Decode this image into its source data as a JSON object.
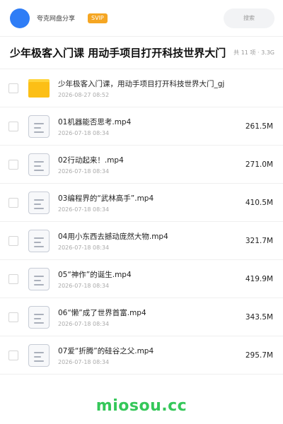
{
  "header": {
    "app_name": "夸克网盘分享",
    "badge": "SVIP",
    "search_placeholder": "搜索"
  },
  "share": {
    "title": "少年极客入门课 用动手项目打开科技世界大门",
    "meta": "共 11 项 · 3.3G"
  },
  "files": [
    {
      "name": "少年极客入门课，用动手项目打开科技世界大门_gj",
      "date": "2026-08-27 08:52",
      "size": "",
      "type": "folder-icon"
    },
    {
      "name": "01机器能否思考.mp4",
      "date": "2026-07-18 08:34",
      "size": "261.5M",
      "type": "file-icon"
    },
    {
      "name": "02行动起来！.mp4",
      "date": "2026-07-18 08:34",
      "size": "271.0M",
      "type": "file-icon"
    },
    {
      "name": "03编程界的“武林高手”.mp4",
      "date": "2026-07-18 08:34",
      "size": "410.5M",
      "type": "file-icon"
    },
    {
      "name": "04用小东西去撼动庞然大物.mp4",
      "date": "2026-07-18 08:34",
      "size": "321.7M",
      "type": "file-icon"
    },
    {
      "name": "05“神作”的诞生.mp4",
      "date": "2026-07-18 08:34",
      "size": "419.9M",
      "type": "file-icon"
    },
    {
      "name": "06“懒”成了世界首富.mp4",
      "date": "2026-07-18 08:34",
      "size": "343.5M",
      "type": "file-icon"
    },
    {
      "name": "07爱“折腾”的硅谷之父.mp4",
      "date": "2026-07-18 08:34",
      "size": "295.7M",
      "type": "file-icon"
    }
  ],
  "footer": {
    "brand": "miosou.cc"
  },
  "colors": {
    "accent": "#2f7df6",
    "badge": "#f5a623",
    "brand": "#34c759",
    "folder": "#fcbf16"
  }
}
